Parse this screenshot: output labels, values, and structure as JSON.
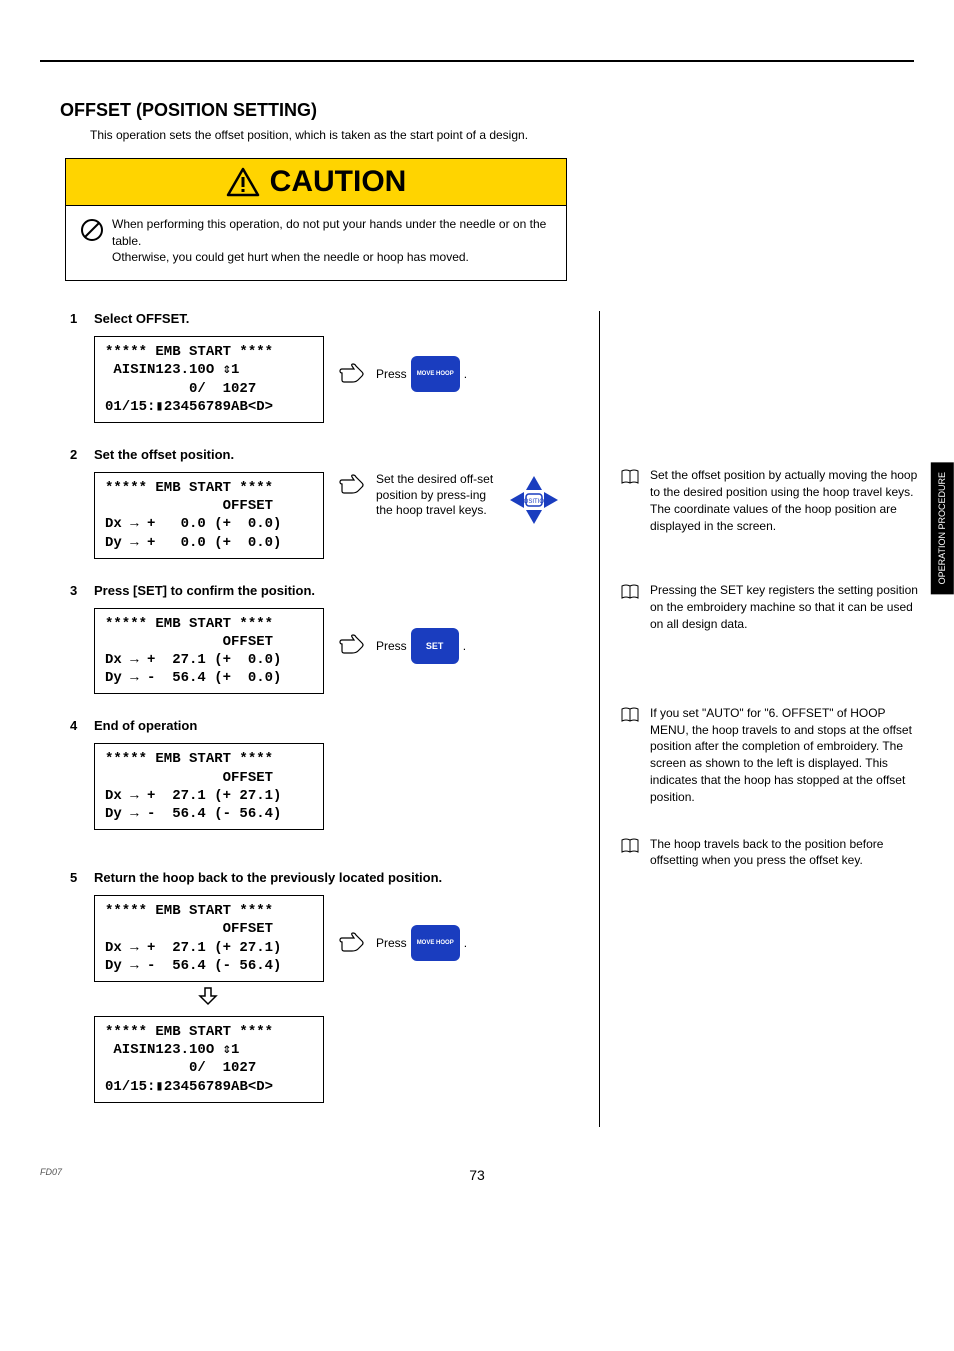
{
  "sideTab": "OPERATION PROCEDURE",
  "title": "OFFSET (POSITION SETTING)",
  "intro": "This operation sets the offset position, which is taken as the start point of a design.",
  "caution": {
    "word": "CAUTION",
    "line1": "When performing this operation, do not put your hands under the needle or on the table.",
    "line2": "Otherwise, you could get hurt when the needle or hoop has moved."
  },
  "steps": {
    "s1": {
      "num": "1",
      "head": "Select OFFSET.",
      "lcd": "***** EMB START ****\n AISIN123.10O ⇕1\n          0/  1027\n01/15:▮23456789AB<D>",
      "press": "Press",
      "btn": "MOVE HOOP",
      "dot": "."
    },
    "s2": {
      "num": "2",
      "head": "Set the offset position.",
      "lcd": "***** EMB START ****\n              OFFSET\nDx → +   0.0 (+  0.0)\nDy → +   0.0 (+  0.0)",
      "instr": "Set the desired off-set position by press-ing the hoop travel keys."
    },
    "s3": {
      "num": "3",
      "head": "Press [SET] to confirm the position.",
      "lcd": "***** EMB START ****\n              OFFSET\nDx → +  27.1 (+  0.0)\nDy → -  56.4 (+  0.0)",
      "press": "Press",
      "btn": "SET",
      "dot": "."
    },
    "s4": {
      "num": "4",
      "head": "End of operation",
      "lcd": "***** EMB START ****\n              OFFSET\nDx → +  27.1 (+ 27.1)\nDy → -  56.4 (- 56.4)"
    },
    "s5": {
      "num": "5",
      "head": "Return the hoop back to the previously located position.",
      "lcd1": "***** EMB START ****\n              OFFSET\nDx → +  27.1 (+ 27.1)\nDy → -  56.4 (- 56.4)",
      "lcd2": "***** EMB START ****\n AISIN123.10O ⇕1\n          0/  1027\n01/15:▮23456789AB<D>",
      "press": "Press",
      "btn": "MOVE HOOP",
      "dot": "."
    }
  },
  "notes": {
    "n2": "Set the offset position by actually moving the hoop to the desired position using the hoop travel keys. The coordinate values of the hoop position are displayed in the screen.",
    "n3": "Pressing the SET key registers the setting position on the embroidery machine so that it can be used on all design data.",
    "n4": "If you set \"AUTO\" for \"6. OFFSET\" of HOOP MENU, the hoop travels to and stops at the offset position after the completion of embroidery. The screen as shown to the left is displayed.  This indicates that the hoop has stopped at the offset position.",
    "n5": "The hoop travels back to the position before offsetting when you press the offset key."
  },
  "footer": {
    "page": "73",
    "fd": "FD07"
  }
}
